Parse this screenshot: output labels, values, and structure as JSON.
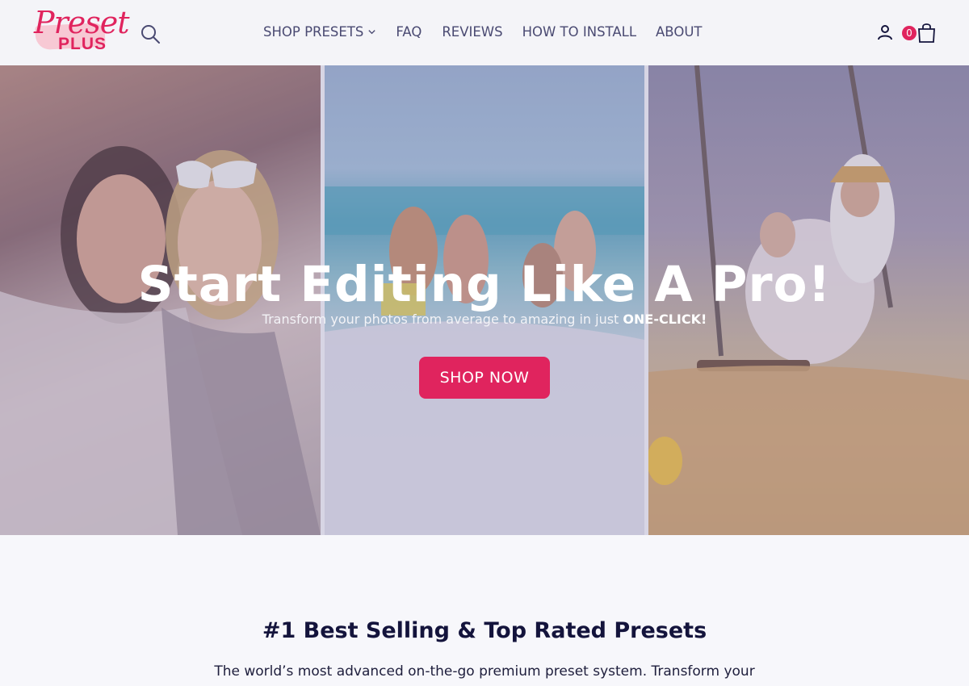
{
  "brand": {
    "logo_script": "Preset",
    "logo_plus": "PLUS",
    "accent_color": "#e0245e"
  },
  "header": {
    "search_icon": "search-icon",
    "nav": [
      {
        "label": "SHOP PRESETS",
        "has_dropdown": true
      },
      {
        "label": "FAQ"
      },
      {
        "label": "REVIEWS"
      },
      {
        "label": "HOW TO INSTALL"
      },
      {
        "label": "ABOUT"
      }
    ],
    "account_icon": "user-icon",
    "cart_count": "0",
    "cart_icon": "shopping-bag-icon"
  },
  "hero": {
    "title": "Start Editing Like A Pro!",
    "subtitle": "Transform your photos from average to amazing in just",
    "subtitle_emphasis": "ONE-CLICK!",
    "cta": "SHOP NOW"
  },
  "section": {
    "title": "#1 Best Selling & Top Rated Presets",
    "text": "The world’s most advanced on-the-go premium preset system. Transform your"
  }
}
